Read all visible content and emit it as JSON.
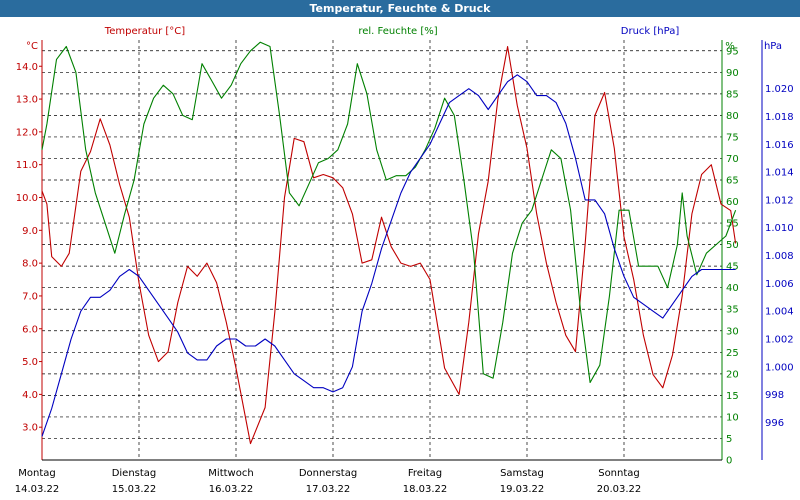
{
  "title": "Temperatur, Feuchte & Druck",
  "colors": {
    "temperature": "#c00000",
    "humidity": "#008000",
    "pressure": "#0000c0",
    "grid": "#000000",
    "title_bg": "#2a6c9e"
  },
  "chart_data": {
    "type": "line",
    "legend": {
      "temperature": "Temperatur [°C]",
      "humidity": "rel. Feuchte [%]",
      "pressure": "Druck [hPa]"
    },
    "axes": {
      "temperature": {
        "unit": "°C",
        "ylim": [
          2.0,
          14.8
        ],
        "ticks": [
          "3.0",
          "4.0",
          "5.0",
          "6.0",
          "7.0",
          "8.0",
          "9.0",
          "10.0",
          "11.0",
          "12.0",
          "13.0",
          "14.0"
        ]
      },
      "humidity": {
        "unit": "%",
        "ylim": [
          0,
          97.5
        ],
        "ticks": [
          "0",
          "5",
          "10",
          "15",
          "20",
          "25",
          "30",
          "35",
          "40",
          "45",
          "50",
          "55",
          "60",
          "65",
          "70",
          "75",
          "80",
          "85",
          "90",
          "95"
        ]
      },
      "pressure": {
        "unit": "hPa",
        "ylim": [
          993.3,
          1023.5
        ],
        "ticks": [
          "996",
          "998",
          "1.000",
          "1.002",
          "1.004",
          "1.006",
          "1.008",
          "1.010",
          "1.012",
          "1.014",
          "1.016",
          "1.018",
          "1.020"
        ]
      }
    },
    "x": {
      "range": [
        0,
        7
      ],
      "days": [
        {
          "day": "Montag",
          "date": "14.03.22"
        },
        {
          "day": "Dienstag",
          "date": "15.03.22"
        },
        {
          "day": "Mittwoch",
          "date": "16.03.22"
        },
        {
          "day": "Donnerstag",
          "date": "17.03.22"
        },
        {
          "day": "Freitag",
          "date": "18.03.22"
        },
        {
          "day": "Samstag",
          "date": "19.03.22"
        },
        {
          "day": "Sonntag",
          "date": "20.03.22"
        }
      ]
    },
    "series": [
      {
        "name": "Temperatur [°C]",
        "key": "temperature",
        "points": [
          [
            0,
            10.2
          ],
          [
            0.05,
            9.8
          ],
          [
            0.1,
            8.2
          ],
          [
            0.2,
            7.9
          ],
          [
            0.28,
            8.3
          ],
          [
            0.4,
            10.8
          ],
          [
            0.5,
            11.4
          ],
          [
            0.6,
            12.4
          ],
          [
            0.7,
            11.6
          ],
          [
            0.8,
            10.4
          ],
          [
            0.9,
            9.4
          ],
          [
            1.0,
            7.4
          ],
          [
            1.1,
            5.8
          ],
          [
            1.2,
            5.0
          ],
          [
            1.3,
            5.3
          ],
          [
            1.4,
            6.8
          ],
          [
            1.5,
            7.9
          ],
          [
            1.6,
            7.6
          ],
          [
            1.7,
            8.0
          ],
          [
            1.8,
            7.4
          ],
          [
            1.9,
            6.2
          ],
          [
            2.0,
            4.8
          ],
          [
            2.15,
            2.5
          ],
          [
            2.3,
            3.6
          ],
          [
            2.4,
            6.5
          ],
          [
            2.5,
            10.0
          ],
          [
            2.6,
            11.8
          ],
          [
            2.7,
            11.7
          ],
          [
            2.8,
            10.6
          ],
          [
            2.9,
            10.7
          ],
          [
            3.0,
            10.6
          ],
          [
            3.1,
            10.3
          ],
          [
            3.2,
            9.5
          ],
          [
            3.3,
            8.0
          ],
          [
            3.4,
            8.1
          ],
          [
            3.5,
            9.4
          ],
          [
            3.6,
            8.5
          ],
          [
            3.7,
            8.0
          ],
          [
            3.8,
            7.9
          ],
          [
            3.9,
            8.0
          ],
          [
            4.0,
            7.5
          ],
          [
            4.15,
            4.8
          ],
          [
            4.3,
            4.0
          ],
          [
            4.4,
            6.2
          ],
          [
            4.5,
            8.9
          ],
          [
            4.6,
            10.5
          ],
          [
            4.7,
            13.0
          ],
          [
            4.8,
            14.6
          ],
          [
            4.9,
            12.8
          ],
          [
            5.0,
            11.5
          ],
          [
            5.1,
            9.5
          ],
          [
            5.2,
            8.0
          ],
          [
            5.3,
            6.8
          ],
          [
            5.4,
            5.8
          ],
          [
            5.5,
            5.3
          ],
          [
            5.6,
            8.6
          ],
          [
            5.7,
            12.5
          ],
          [
            5.8,
            13.2
          ],
          [
            5.9,
            11.5
          ],
          [
            6.0,
            8.8
          ],
          [
            6.1,
            7.5
          ],
          [
            6.2,
            5.8
          ],
          [
            6.3,
            4.6
          ],
          [
            6.4,
            4.2
          ],
          [
            6.5,
            5.2
          ],
          [
            6.6,
            7.0
          ],
          [
            6.7,
            9.5
          ],
          [
            6.8,
            10.7
          ],
          [
            6.9,
            11.0
          ],
          [
            7.0,
            9.8
          ],
          [
            7.1,
            9.6
          ],
          [
            7.15,
            8.6
          ]
        ]
      },
      {
        "name": "rel. Feuchte [%]",
        "key": "humidity",
        "points": [
          [
            0,
            72
          ],
          [
            0.05,
            78
          ],
          [
            0.15,
            93
          ],
          [
            0.25,
            96
          ],
          [
            0.35,
            90
          ],
          [
            0.45,
            72
          ],
          [
            0.55,
            62
          ],
          [
            0.65,
            55
          ],
          [
            0.75,
            48
          ],
          [
            0.85,
            57
          ],
          [
            0.95,
            65
          ],
          [
            1.05,
            78
          ],
          [
            1.15,
            84
          ],
          [
            1.25,
            87
          ],
          [
            1.35,
            85
          ],
          [
            1.45,
            80
          ],
          [
            1.55,
            79
          ],
          [
            1.65,
            92
          ],
          [
            1.75,
            88
          ],
          [
            1.85,
            84
          ],
          [
            1.95,
            87
          ],
          [
            2.05,
            92
          ],
          [
            2.15,
            95
          ],
          [
            2.25,
            97
          ],
          [
            2.35,
            96
          ],
          [
            2.45,
            80
          ],
          [
            2.55,
            62
          ],
          [
            2.65,
            59
          ],
          [
            2.75,
            64
          ],
          [
            2.85,
            69
          ],
          [
            2.95,
            70
          ],
          [
            3.05,
            72
          ],
          [
            3.15,
            78
          ],
          [
            3.25,
            92
          ],
          [
            3.35,
            85
          ],
          [
            3.45,
            72
          ],
          [
            3.55,
            65
          ],
          [
            3.65,
            66
          ],
          [
            3.75,
            66
          ],
          [
            3.85,
            68
          ],
          [
            3.95,
            72
          ],
          [
            4.05,
            77
          ],
          [
            4.15,
            84
          ],
          [
            4.25,
            80
          ],
          [
            4.35,
            65
          ],
          [
            4.45,
            48
          ],
          [
            4.55,
            20
          ],
          [
            4.65,
            19
          ],
          [
            4.75,
            32
          ],
          [
            4.85,
            48
          ],
          [
            4.95,
            55
          ],
          [
            5.05,
            58
          ],
          [
            5.15,
            65
          ],
          [
            5.25,
            72
          ],
          [
            5.35,
            70
          ],
          [
            5.45,
            58
          ],
          [
            5.55,
            35
          ],
          [
            5.65,
            18
          ],
          [
            5.75,
            22
          ],
          [
            5.85,
            38
          ],
          [
            5.95,
            58
          ],
          [
            6.05,
            58
          ],
          [
            6.15,
            45
          ],
          [
            6.25,
            45
          ],
          [
            6.35,
            45
          ],
          [
            6.45,
            40
          ],
          [
            6.55,
            50
          ],
          [
            6.6,
            62
          ],
          [
            6.65,
            52
          ],
          [
            6.75,
            43
          ],
          [
            6.85,
            48
          ],
          [
            6.95,
            50
          ],
          [
            7.05,
            52
          ],
          [
            7.15,
            58
          ]
        ]
      },
      {
        "name": "Druck [hPa]",
        "key": "pressure",
        "points": [
          [
            0,
            995.0
          ],
          [
            0.1,
            997.0
          ],
          [
            0.2,
            999.5
          ],
          [
            0.3,
            1002.0
          ],
          [
            0.4,
            1004.0
          ],
          [
            0.5,
            1005.0
          ],
          [
            0.6,
            1005.0
          ],
          [
            0.7,
            1005.5
          ],
          [
            0.8,
            1006.5
          ],
          [
            0.9,
            1007.0
          ],
          [
            1.0,
            1006.5
          ],
          [
            1.1,
            1005.5
          ],
          [
            1.2,
            1004.5
          ],
          [
            1.3,
            1003.5
          ],
          [
            1.4,
            1002.5
          ],
          [
            1.5,
            1001.0
          ],
          [
            1.6,
            1000.5
          ],
          [
            1.7,
            1000.5
          ],
          [
            1.8,
            1001.5
          ],
          [
            1.9,
            1002.0
          ],
          [
            2.0,
            1002.0
          ],
          [
            2.1,
            1001.5
          ],
          [
            2.2,
            1001.5
          ],
          [
            2.3,
            1002.0
          ],
          [
            2.4,
            1001.5
          ],
          [
            2.5,
            1000.5
          ],
          [
            2.6,
            999.5
          ],
          [
            2.7,
            999.0
          ],
          [
            2.8,
            998.5
          ],
          [
            2.9,
            998.5
          ],
          [
            3.0,
            998.2
          ],
          [
            3.1,
            998.5
          ],
          [
            3.2,
            1000.0
          ],
          [
            3.3,
            1004.0
          ],
          [
            3.4,
            1006.0
          ],
          [
            3.5,
            1008.5
          ],
          [
            3.6,
            1010.5
          ],
          [
            3.7,
            1012.5
          ],
          [
            3.8,
            1014.0
          ],
          [
            3.9,
            1015.0
          ],
          [
            4.0,
            1016.0
          ],
          [
            4.1,
            1017.5
          ],
          [
            4.2,
            1019.0
          ],
          [
            4.3,
            1019.5
          ],
          [
            4.4,
            1020.0
          ],
          [
            4.5,
            1019.5
          ],
          [
            4.6,
            1018.5
          ],
          [
            4.7,
            1019.5
          ],
          [
            4.8,
            1020.5
          ],
          [
            4.9,
            1021.0
          ],
          [
            5.0,
            1020.5
          ],
          [
            5.1,
            1019.5
          ],
          [
            5.2,
            1019.5
          ],
          [
            5.3,
            1019.0
          ],
          [
            5.4,
            1017.5
          ],
          [
            5.5,
            1015.0
          ],
          [
            5.6,
            1012.0
          ],
          [
            5.7,
            1012.0
          ],
          [
            5.8,
            1011.0
          ],
          [
            5.9,
            1008.5
          ],
          [
            6.0,
            1006.5
          ],
          [
            6.1,
            1005.0
          ],
          [
            6.2,
            1004.5
          ],
          [
            6.3,
            1004.0
          ],
          [
            6.4,
            1003.5
          ],
          [
            6.5,
            1004.5
          ],
          [
            6.6,
            1005.5
          ],
          [
            6.7,
            1006.5
          ],
          [
            6.8,
            1007.0
          ],
          [
            7.0,
            1007.0
          ],
          [
            7.15,
            1007.0
          ]
        ]
      }
    ]
  }
}
